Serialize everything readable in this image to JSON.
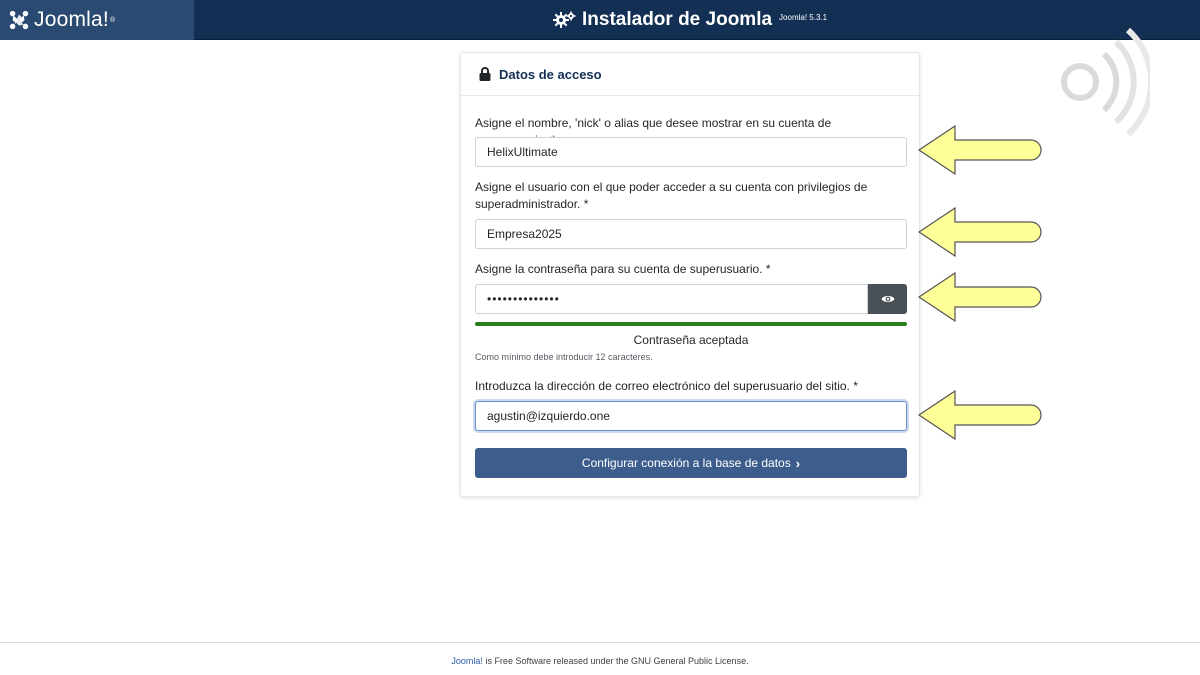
{
  "header": {
    "brand": "Joomla!",
    "brand_mark": "®",
    "title": "Instalador de Joomla",
    "version": "Joomla! 5.3.1"
  },
  "card": {
    "title": "Datos de acceso",
    "fields": [
      {
        "label": "Asigne el nombre, 'nick' o alias que desee mostrar en su cuenta de superusuario. *",
        "value": "HelixUltimate"
      },
      {
        "label": "Asigne el usuario con el que poder acceder a su cuenta con privilegios de superadministrador. *",
        "value": "Empresa2025"
      },
      {
        "label": "Asigne la contraseña para su cuenta de superusuario. *",
        "value": "••••••••••••••"
      },
      {
        "label": "Introduzca la dirección de correo electrónico del superusuario del sitio. *",
        "value": "agustin@izquierdo.one"
      }
    ],
    "password_meter": {
      "status": "Contraseña aceptada",
      "strength": 1.0,
      "hint": "Como mínimo debe introducir 12 caracteres."
    },
    "submit_label": "Configurar conexión a la base de datos",
    "submit_icon": "chevron-right-icon"
  },
  "annotations": {
    "arrow_color": "#ffff99",
    "arrow_count": 4
  },
  "footer": {
    "link_text": "Joomla!",
    "text": " is Free Software released under the GNU General Public License."
  },
  "colors": {
    "header_bg": "#132f53",
    "brand_bg": "#2a4a72",
    "button_bg": "#3d5e8c",
    "meter": "#2b7d1f"
  }
}
